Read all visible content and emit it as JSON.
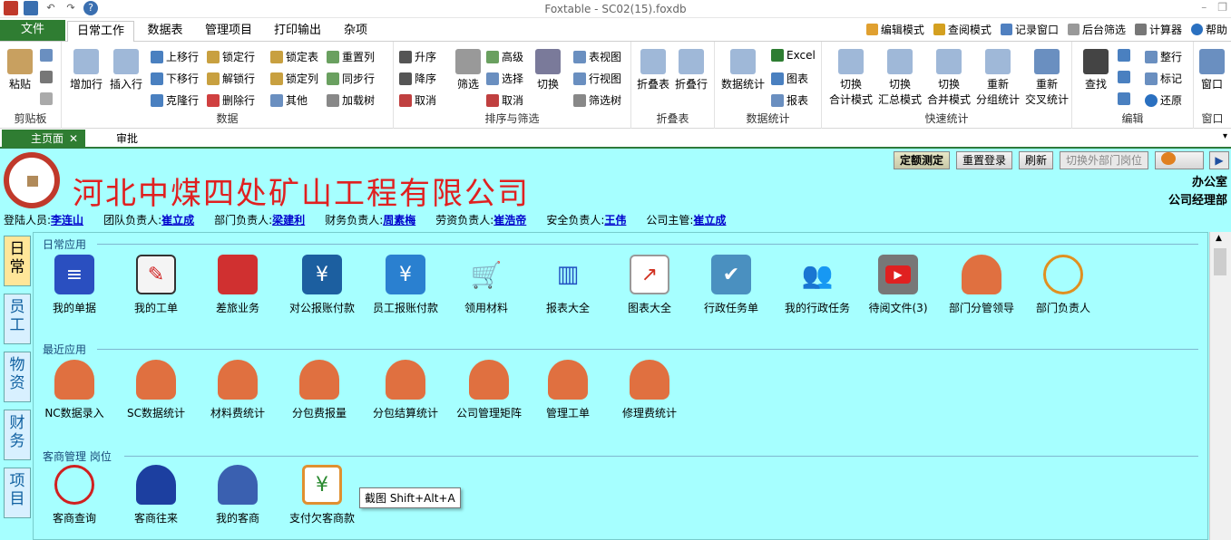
{
  "window": {
    "title": "Foxtable - SC02(15).foxdb"
  },
  "menu": {
    "file": "文件",
    "tabs": [
      "日常工作",
      "数据表",
      "管理项目",
      "打印输出",
      "杂项"
    ]
  },
  "modes": [
    "编辑模式",
    "查阅模式",
    "记录窗口",
    "后台筛选",
    "计算器",
    "帮助"
  ],
  "ribbon": {
    "clipboard": {
      "name": "剪贴板",
      "paste": "粘贴"
    },
    "data": {
      "name": "数据",
      "add_row": "增加行",
      "insert_row": "插入行",
      "up": "上移行",
      "down": "下移行",
      "dup": "克隆行",
      "lock_row": "锁定行",
      "unlock_row": "解锁行",
      "del_row": "删除行",
      "lock_table": "锁定表",
      "lock_col": "锁定列",
      "other": "其他",
      "reset_col": "重置列",
      "sync_row": "同步行",
      "load_tree": "加载树"
    },
    "sort": {
      "name": "排序与筛选",
      "asc": "升序",
      "desc": "降序",
      "cancel": "取消",
      "filter": "筛选",
      "advanced": "高级",
      "select": "选择",
      "cancel2": "取消",
      "switch": "切换",
      "table_view": "表视图",
      "row_view": "行视图",
      "filter_tree": "筛选树"
    },
    "fold": {
      "name": "折叠表",
      "fold_table": "折叠表",
      "fold_row": "折叠行"
    },
    "datastat": {
      "name": "数据统计",
      "stat": "数据统计",
      "excel": "Excel",
      "chart": "图表",
      "report": "报表"
    },
    "quick": {
      "name": "快速统计",
      "items": [
        "切换\n合计模式",
        "切换\n汇总模式",
        "切换\n合并模式",
        "重新\n分组统计",
        "重新\n交叉统计"
      ]
    },
    "edit": {
      "name": "编辑",
      "find": "查找",
      "tidy": "整行",
      "mark": "标记",
      "restore": "还原"
    },
    "window": {
      "name": "窗口",
      "window": "窗口"
    }
  },
  "doctabs": {
    "home": "主页面",
    "approve": "审批"
  },
  "header": {
    "company": "河北中煤四处矿山工程有限公司",
    "buttons": [
      "定额测定",
      "重置登录",
      "刷新",
      "切换外部门岗位"
    ],
    "dept1": "办公室",
    "dept2": "公司经理部"
  },
  "info": [
    {
      "label": "登陆人员:",
      "value": "李连山"
    },
    {
      "label": "团队负责人:",
      "value": "崔立成"
    },
    {
      "label": "部门负责人:",
      "value": "梁建利"
    },
    {
      "label": "财务负责人:",
      "value": "周素梅"
    },
    {
      "label": "劳资负责人:",
      "value": "崔浩帝"
    },
    {
      "label": "安全负责人:",
      "value": "王伟"
    },
    {
      "label": "公司主管:",
      "value": "崔立成"
    }
  ],
  "vtabs": [
    "日常",
    "员工",
    "物资",
    "财务",
    "项目"
  ],
  "sections": {
    "daily": {
      "title": "日常应用",
      "items": [
        "我的单据",
        "我的工单",
        "差旅业务",
        "对公报账付款",
        "员工报账付款",
        "领用材料",
        "报表大全",
        "图表大全",
        "行政任务单",
        "我的行政任务",
        "待阅文件(3)",
        "部门分管领导",
        "部门负责人"
      ]
    },
    "recent": {
      "title": "最近应用",
      "items": [
        "NC数据录入",
        "SC数据统计",
        "材料费统计",
        "分包费报量",
        "分包结算统计",
        "公司管理矩阵",
        "管理工单",
        "修理费统计"
      ]
    },
    "customer": {
      "title": "客商管理  岗位",
      "items": [
        "客商查询",
        "客商往来",
        "我的客商",
        "支付欠客商款"
      ]
    }
  },
  "tooltip": "截图 Shift+Alt+A",
  "colors": {
    "accent": "#2f7d32",
    "panel": "#a6ffff",
    "company": "#e02020"
  }
}
